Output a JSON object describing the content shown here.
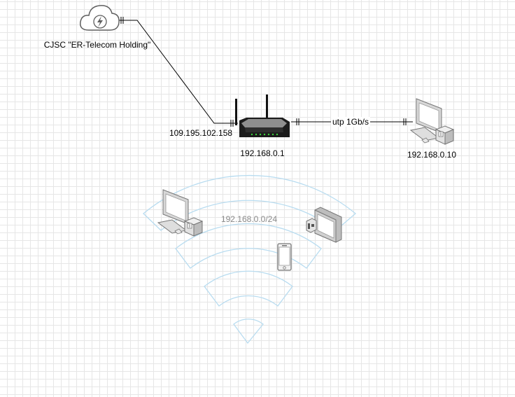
{
  "diagram": {
    "isp_label": "CJSC \"ER-Telecom Holding\"",
    "wan_ip": "109.195.102.158",
    "router_ip": "192.168.0.1",
    "link_label": "utp 1Gb/s",
    "pc_ip": "192.168.0.10",
    "wifi_subnet": "192.168.0.0/24",
    "icons": {
      "isp": "cloud-lightning-icon",
      "router": "wifi-router-icon",
      "pc": "desktop-pc-icon",
      "wifi": "wifi-signal-icon",
      "wireless_pc": "desktop-pc-icon",
      "tablet": "tablet-icon",
      "phone": "smartphone-icon"
    }
  }
}
